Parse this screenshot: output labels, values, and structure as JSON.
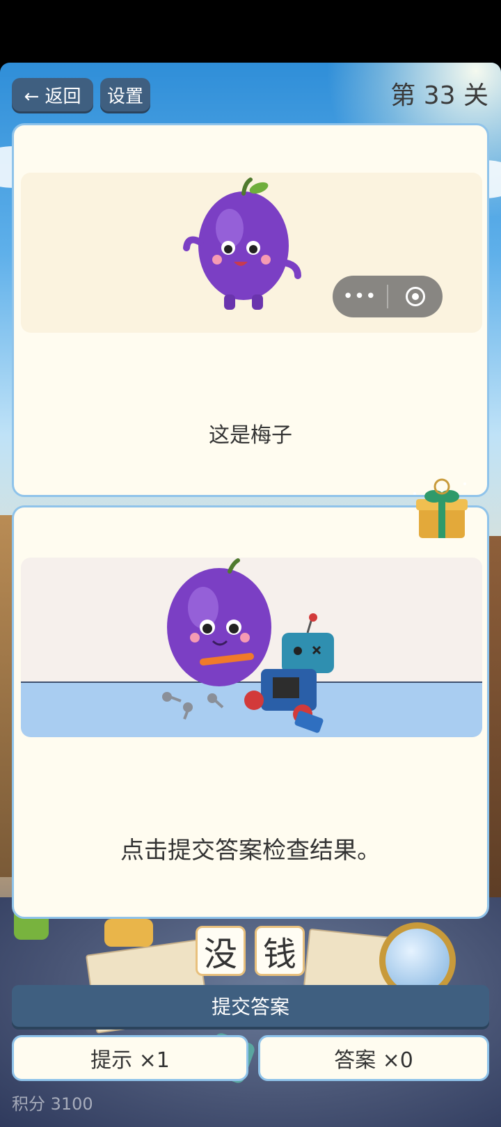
{
  "header": {
    "back_label": "← 返回",
    "settings_label": "设置",
    "level_label": "第 33 关"
  },
  "capsule_menu": {
    "more_icon": "more-dots-icon",
    "close_icon": "target-icon"
  },
  "card1": {
    "image": "plum-character-waving",
    "caption": "这是梅子"
  },
  "card2": {
    "image": "plum-fixing-robot",
    "caption": "点击提交答案检查结果。"
  },
  "gift": {
    "icon": "gift-box-icon"
  },
  "answer_tiles": [
    "没",
    "钱"
  ],
  "submit_label": "提交答案",
  "hint_label": "提示 ×1",
  "answer_label": "答案 ×0",
  "score_label": "积分 3100",
  "colors": {
    "button_bg": "#3f5f80",
    "card_bg": "#fffcf0",
    "card_border": "#8fc3ea",
    "plum": "#7b3fc4"
  }
}
